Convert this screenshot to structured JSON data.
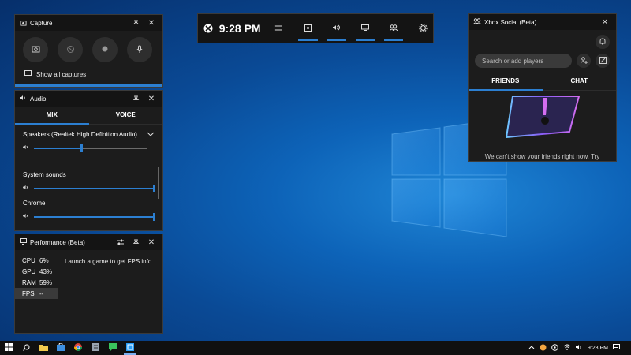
{
  "capture": {
    "title": "Capture",
    "show_all": "Show all captures"
  },
  "audio": {
    "title": "Audio",
    "tabs": [
      "MIX",
      "VOICE"
    ],
    "device": "Speakers (Realtek High Definition Audio)",
    "master_level": 0.43,
    "apps": [
      {
        "name": "System sounds",
        "level": 1.0
      },
      {
        "name": "Chrome",
        "level": 1.0
      }
    ]
  },
  "performance": {
    "title": "Performance (Beta)",
    "stats": [
      {
        "k": "CPU",
        "v": "6%"
      },
      {
        "k": "GPU",
        "v": "43%"
      },
      {
        "k": "RAM",
        "v": "59%"
      },
      {
        "k": "FPS",
        "v": "--"
      }
    ],
    "message": "Launch a game to get FPS info"
  },
  "gamebar": {
    "time": "9:28 PM"
  },
  "social": {
    "title": "Xbox Social (Beta)",
    "search_placeholder": "Search or add players",
    "tabs": [
      "FRIENDS",
      "CHAT"
    ],
    "message": "We can't show your friends right now. Try"
  },
  "taskbar": {
    "time": "9:28 PM"
  },
  "colors": {
    "accent": "#2c7fd1",
    "panel": "#1c1c1c"
  }
}
